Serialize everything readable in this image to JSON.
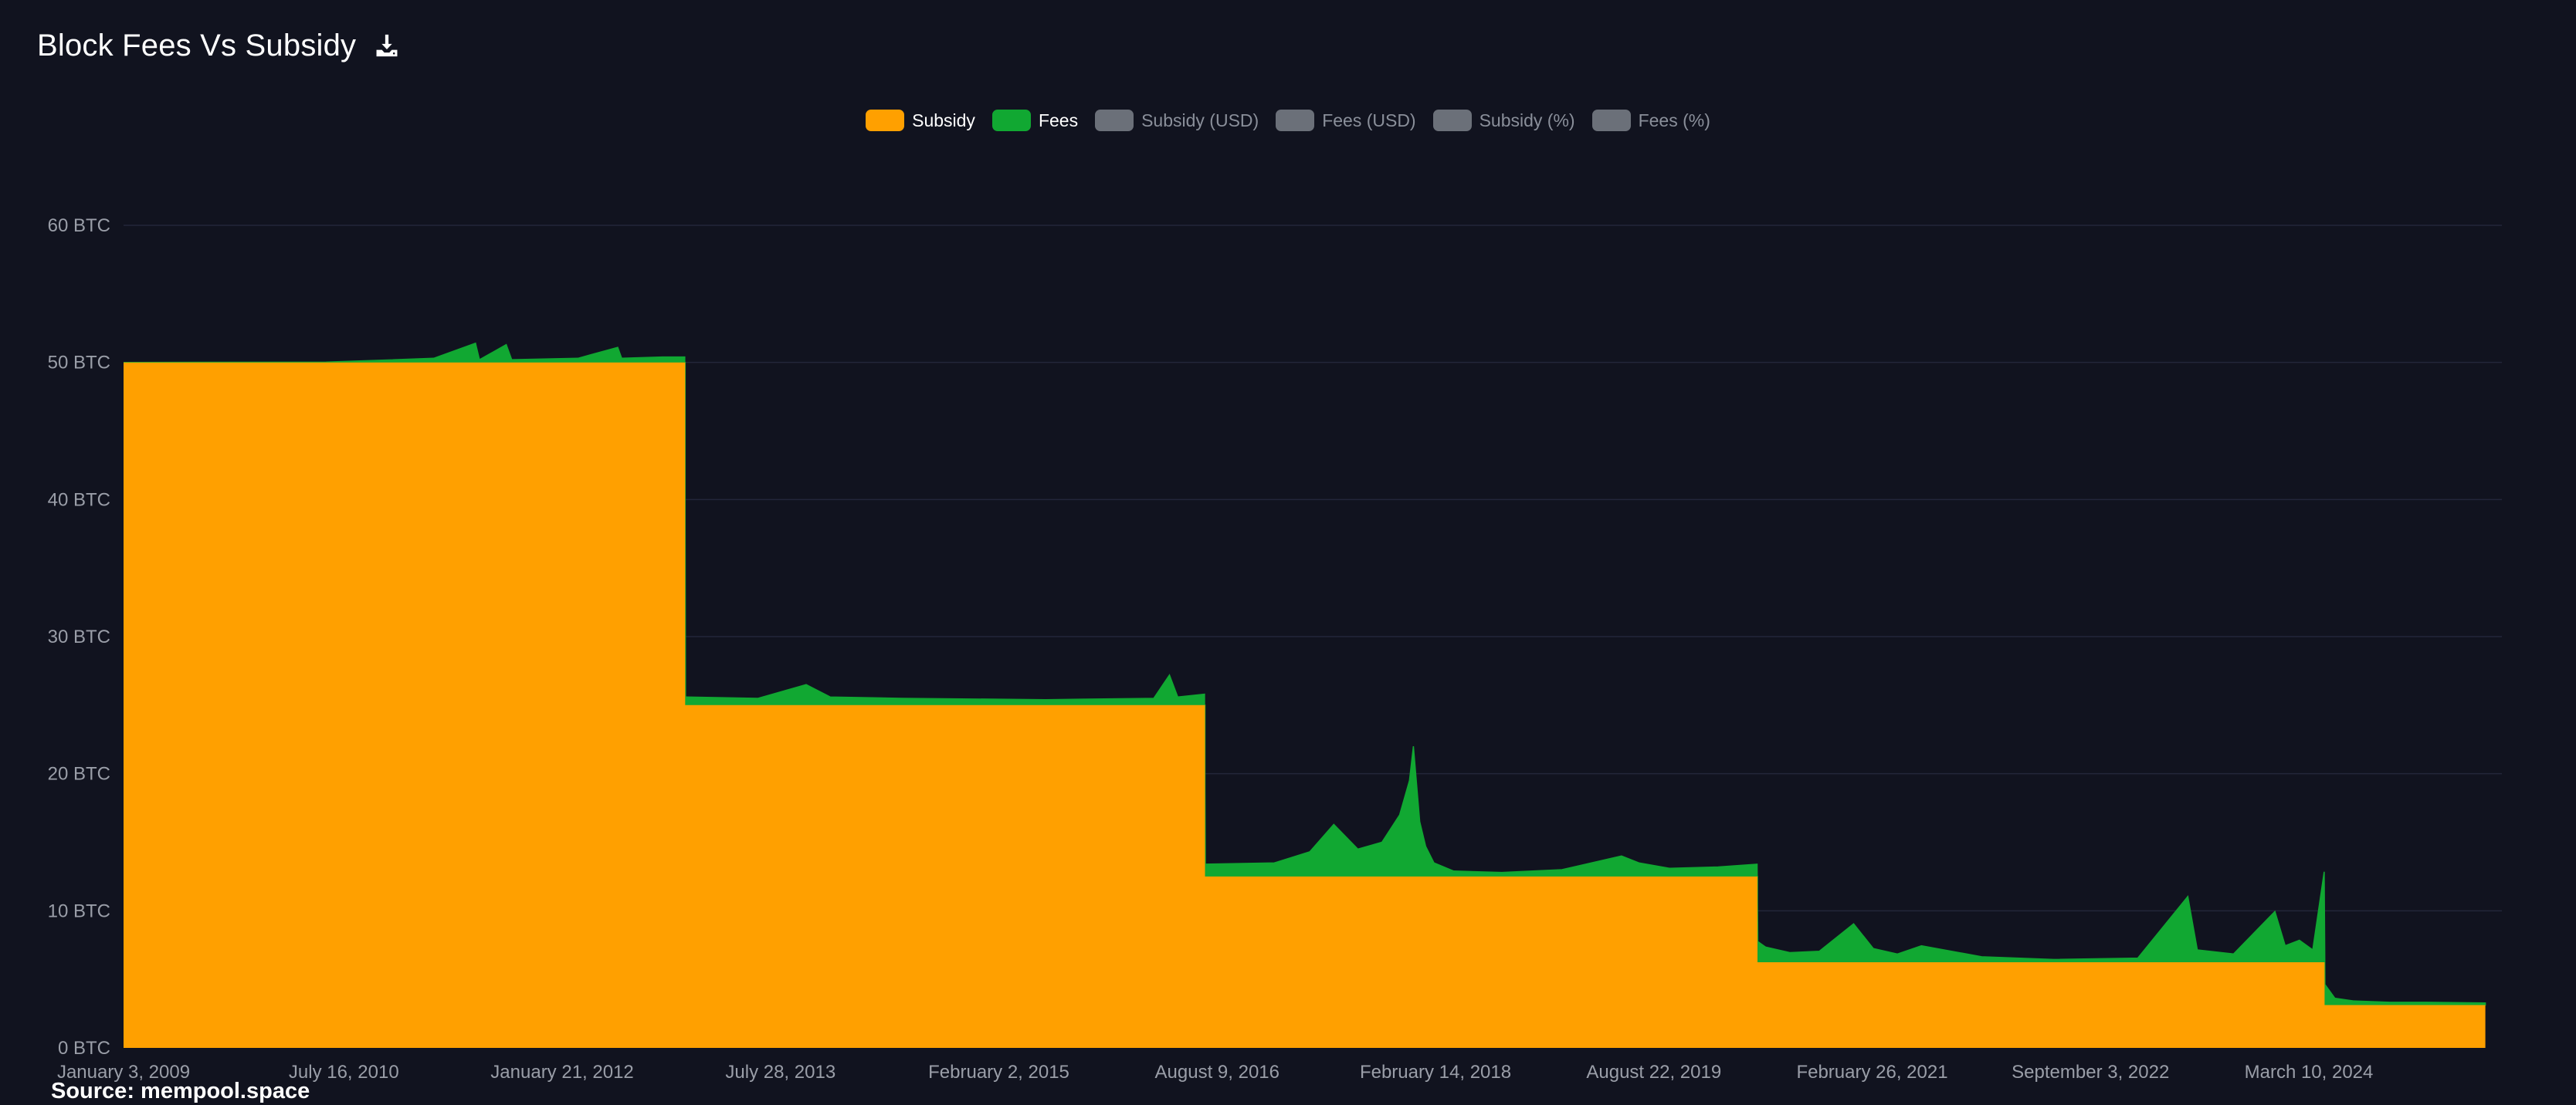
{
  "title": "Block Fees Vs Subsidy",
  "icons": {
    "download": "download-icon"
  },
  "legend": [
    {
      "label": "Subsidy",
      "color": "#ffa000",
      "active": true
    },
    {
      "label": "Fees",
      "color": "#11a832",
      "active": true
    },
    {
      "label": "Subsidy (USD)",
      "color": "#6b7079",
      "active": false
    },
    {
      "label": "Fees (USD)",
      "color": "#6b7079",
      "active": false
    },
    {
      "label": "Subsidy (%)",
      "color": "#6b7079",
      "active": false
    },
    {
      "label": "Fees (%)",
      "color": "#6b7079",
      "active": false
    }
  ],
  "source": "Source: mempool.space",
  "colors": {
    "background": "#11131f",
    "subsidy": "#ffa000",
    "fees": "#11a832",
    "grid": "#23263a",
    "axis_text": "#9a9ea8"
  },
  "chart_data": {
    "type": "area",
    "ylim": [
      0,
      60
    ],
    "grid": true,
    "legend_position": "top-center",
    "y_ticks": [
      {
        "value": 0,
        "label": "0 BTC"
      },
      {
        "value": 10,
        "label": "10 BTC"
      },
      {
        "value": 20,
        "label": "20 BTC"
      },
      {
        "value": 30,
        "label": "30 BTC"
      },
      {
        "value": 40,
        "label": "40 BTC"
      },
      {
        "value": 50,
        "label": "50 BTC"
      },
      {
        "value": 60,
        "label": "60 BTC"
      }
    ],
    "x_ticks": [
      "January 3, 2009",
      "July 16, 2010",
      "January 21, 2012",
      "July 28, 2013",
      "February 2, 2015",
      "August 9, 2016",
      "February 14, 2018",
      "August 22, 2019",
      "February 26, 2021",
      "September 3, 2022",
      "March 10, 2024"
    ],
    "series": [
      {
        "name": "Subsidy",
        "color": "#ffa000",
        "x": [
          "2009-01-03",
          "2012-11-28",
          "2012-11-28",
          "2016-07-09",
          "2016-07-09",
          "2020-05-11",
          "2020-05-11",
          "2024-04-19",
          "2024-04-19",
          "2025-06-01"
        ],
        "y": [
          50,
          50,
          25,
          25,
          12.5,
          12.5,
          6.25,
          6.25,
          3.125,
          3.125
        ]
      },
      {
        "name": "Fees",
        "color": "#11a832",
        "x": [
          "2009-01-03",
          "2010-06-01",
          "2011-03-01",
          "2011-06-15",
          "2011-06-25",
          "2011-09-01",
          "2011-09-15",
          "2012-03-01",
          "2012-06-10",
          "2012-06-20",
          "2012-10-01",
          "2012-11-27",
          "2012-11-29",
          "2013-06-01",
          "2013-10-01",
          "2013-12-01",
          "2014-06-01",
          "2015-06-01",
          "2016-03-01",
          "2016-04-10",
          "2016-05-01",
          "2016-07-08",
          "2016-07-10",
          "2017-01-01",
          "2017-04-01",
          "2017-06-01",
          "2017-08-01",
          "2017-10-01",
          "2017-11-15",
          "2017-12-10",
          "2017-12-20",
          "2018-01-05",
          "2018-01-20",
          "2018-02-10",
          "2018-04-01",
          "2018-08-01",
          "2019-01-01",
          "2019-06-01",
          "2019-07-15",
          "2019-10-01",
          "2020-02-01",
          "2020-05-10",
          "2020-05-12",
          "2020-06-01",
          "2020-08-01",
          "2020-10-15",
          "2021-01-10",
          "2021-03-01",
          "2021-05-01",
          "2021-07-01",
          "2021-12-01",
          "2022-06-01",
          "2023-01-01",
          "2023-05-08",
          "2023-06-01",
          "2023-09-01",
          "2023-12-15",
          "2024-01-10",
          "2024-02-15",
          "2024-03-20",
          "2024-04-18",
          "2024-04-20",
          "2024-05-15",
          "2024-07-01",
          "2024-10-01",
          "2025-01-01",
          "2025-06-01"
        ],
        "y": [
          0,
          0.02,
          0.3,
          1.4,
          0.2,
          1.3,
          0.2,
          0.3,
          1.1,
          0.3,
          0.4,
          0.4,
          0.6,
          0.5,
          1.5,
          0.6,
          0.5,
          0.4,
          0.5,
          2.2,
          0.6,
          0.8,
          0.9,
          1.0,
          1.8,
          3.8,
          2.0,
          2.5,
          4.5,
          7.0,
          9.5,
          4.0,
          2.2,
          1.0,
          0.4,
          0.3,
          0.5,
          1.5,
          1.0,
          0.6,
          0.7,
          0.9,
          1.5,
          1.1,
          0.7,
          0.8,
          2.8,
          1.0,
          0.6,
          1.2,
          0.4,
          0.2,
          0.3,
          4.8,
          0.9,
          0.6,
          3.7,
          1.2,
          1.6,
          0.9,
          6.6,
          1.5,
          0.5,
          0.3,
          0.2,
          0.2,
          0.15
        ]
      }
    ]
  }
}
